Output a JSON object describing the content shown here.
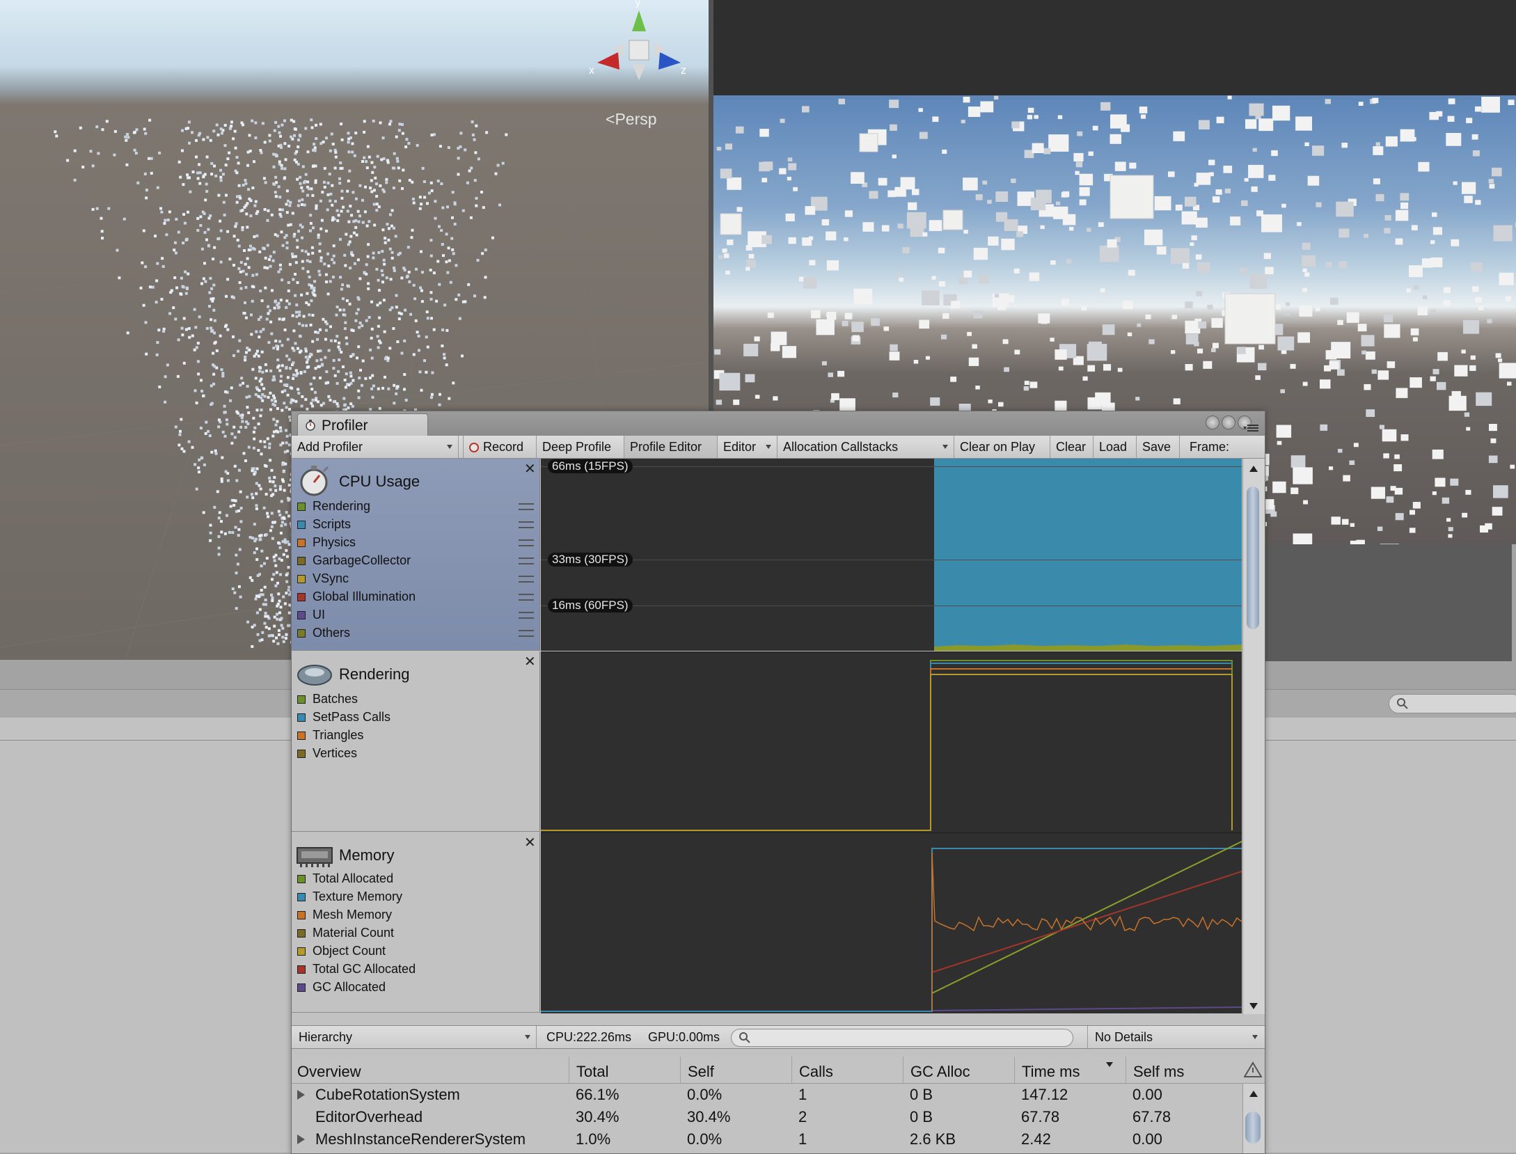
{
  "scene": {
    "view_mode_label": "Persp",
    "gizmo_axes": {
      "x": "x",
      "y": "y",
      "z": "z"
    }
  },
  "profiler": {
    "tab_title": "Profiler",
    "toolbar": {
      "add_profiler": "Add Profiler",
      "record": "Record",
      "deep_profile": "Deep Profile",
      "profile_editor": "Profile Editor",
      "target": "Editor",
      "allocation_callstacks": "Allocation Callstacks",
      "clear_on_play": "Clear on Play",
      "clear": "Clear",
      "load": "Load",
      "save": "Save",
      "frame": "Frame:"
    },
    "modules": {
      "cpu": {
        "title": "CPU Usage",
        "items": [
          {
            "label": "Rendering",
            "color": "#6b8f2a"
          },
          {
            "label": "Scripts",
            "color": "#3a8ab0"
          },
          {
            "label": "Physics",
            "color": "#c8732a"
          },
          {
            "label": "GarbageCollector",
            "color": "#7a6a28"
          },
          {
            "label": "VSync",
            "color": "#b49a2a"
          },
          {
            "label": "Global Illumination",
            "color": "#a3352a"
          },
          {
            "label": "UI",
            "color": "#5c4a8c"
          },
          {
            "label": "Others",
            "color": "#7a7a2a"
          }
        ],
        "markers": [
          "66ms (15FPS)",
          "33ms (30FPS)",
          "16ms (60FPS)"
        ]
      },
      "rendering": {
        "title": "Rendering",
        "items": [
          {
            "label": "Batches",
            "color": "#6b8f2a"
          },
          {
            "label": "SetPass Calls",
            "color": "#3a8ab0"
          },
          {
            "label": "Triangles",
            "color": "#c8732a"
          },
          {
            "label": "Vertices",
            "color": "#7a6a28"
          }
        ]
      },
      "memory": {
        "title": "Memory",
        "items": [
          {
            "label": "Total Allocated",
            "color": "#6b8f2a"
          },
          {
            "label": "Texture Memory",
            "color": "#3a8ab0"
          },
          {
            "label": "Mesh Memory",
            "color": "#c8732a"
          },
          {
            "label": "Material Count",
            "color": "#7a6a28"
          },
          {
            "label": "Object Count",
            "color": "#b49a2a"
          },
          {
            "label": "Total GC Allocated",
            "color": "#a3352a"
          },
          {
            "label": "GC Allocated",
            "color": "#5c4a8c"
          }
        ]
      }
    },
    "details": {
      "view": "Hierarchy",
      "cpu": "CPU:222.26ms",
      "gpu": "GPU:0.00ms",
      "search_placeholder": "",
      "mode": "No Details"
    },
    "table": {
      "columns": [
        "Overview",
        "Total",
        "Self",
        "Calls",
        "GC Alloc",
        "Time ms",
        "Self ms"
      ],
      "rows": [
        {
          "name": "CubeRotationSystem",
          "total": "66.1%",
          "self": "0.0%",
          "calls": "1",
          "gc": "0 B",
          "time": "147.12",
          "self_ms": "0.00",
          "expandable": true
        },
        {
          "name": "EditorOverhead",
          "total": "30.4%",
          "self": "30.4%",
          "calls": "2",
          "gc": "0 B",
          "time": "67.78",
          "self_ms": "67.78",
          "expandable": false
        },
        {
          "name": "MeshInstanceRendererSystem",
          "total": "1.0%",
          "self": "0.0%",
          "calls": "1",
          "gc": "2.6 KB",
          "time": "2.42",
          "self_ms": "0.00",
          "expandable": true
        }
      ]
    }
  }
}
